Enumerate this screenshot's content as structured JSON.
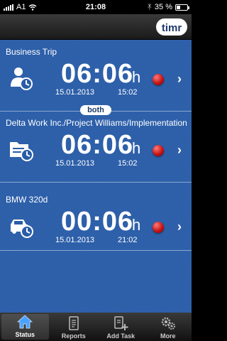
{
  "status_bar": {
    "carrier": "A1",
    "time": "21:08",
    "battery": "35 %",
    "battery_level": 0.35
  },
  "header": {
    "logo_text": "timr"
  },
  "tasks": [
    {
      "title": "Business Trip",
      "duration": "06:06",
      "unit": "h",
      "date": "15.01.2013",
      "time": "15:02",
      "icon": "business-person-icon"
    },
    {
      "title": "Delta Work Inc./Project Williams/Implementation",
      "duration": "06:06",
      "unit": "h",
      "date": "15.01.2013",
      "time": "15:02",
      "icon": "project-folder-icon"
    },
    {
      "title": "BMW 320d",
      "duration": "00:06",
      "unit": "h",
      "date": "15.01.2013",
      "time": "21:02",
      "icon": "car-icon"
    }
  ],
  "badge": {
    "label": "both"
  },
  "tab_bar": {
    "tabs": [
      {
        "label": "Status",
        "icon": "home-icon",
        "active": true
      },
      {
        "label": "Reports",
        "icon": "document-icon",
        "active": false
      },
      {
        "label": "Add Task",
        "icon": "add-document-icon",
        "active": false
      },
      {
        "label": "More",
        "icon": "gears-icon",
        "active": false
      }
    ]
  },
  "colors": {
    "background": "#2a5da8",
    "record": "#c81515",
    "accent": "#1f3a6b"
  }
}
